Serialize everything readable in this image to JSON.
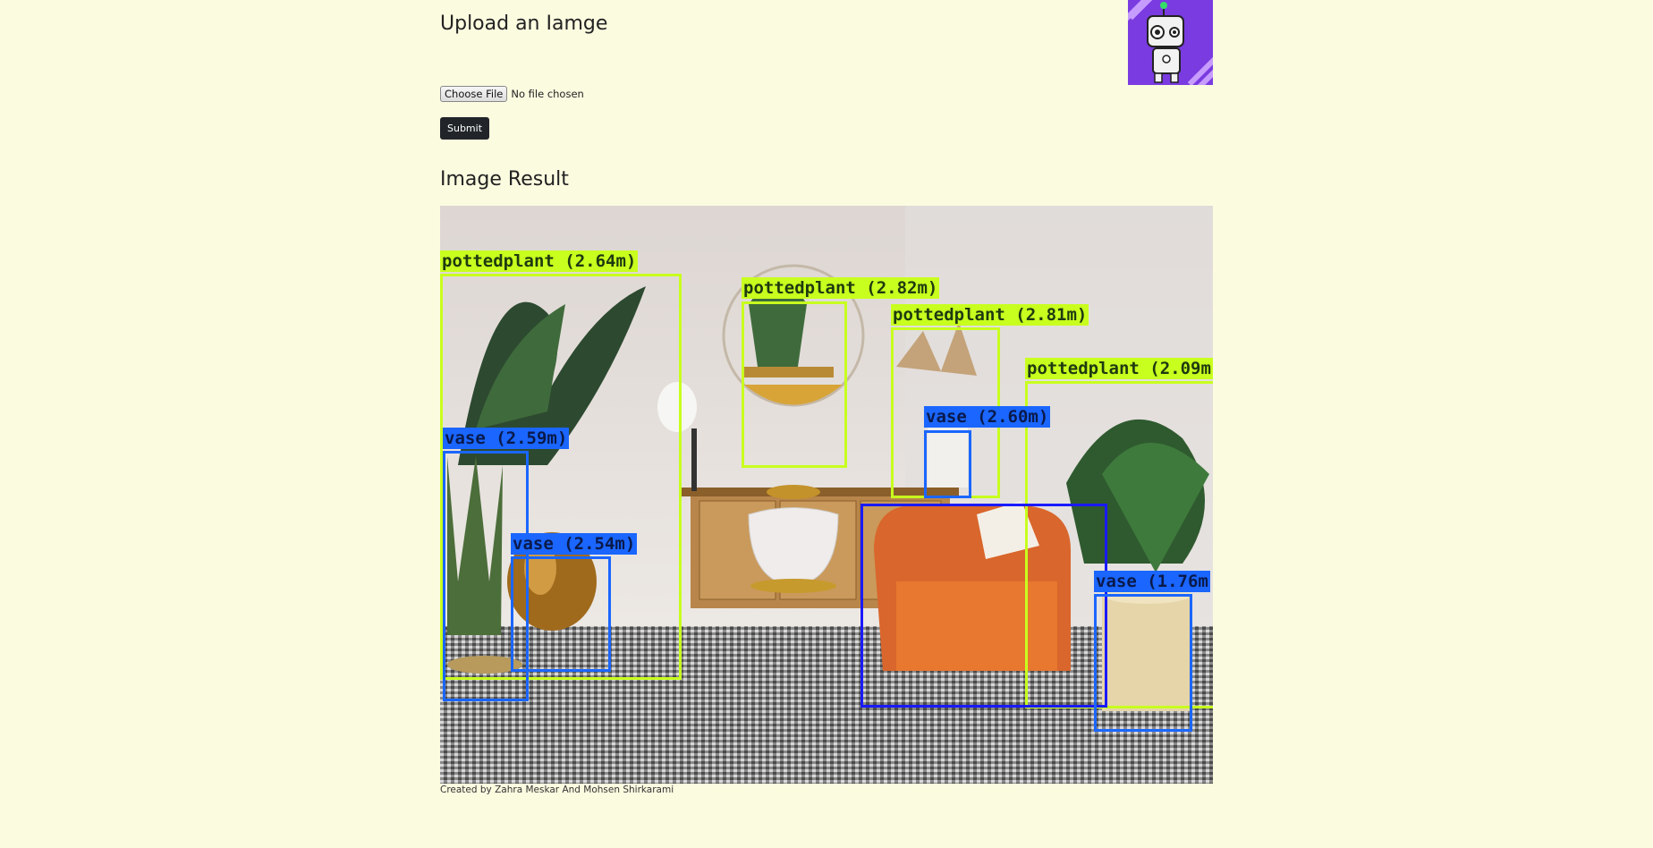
{
  "page": {
    "upload_heading": "Upload an Iamge",
    "choose_file_label": "Choose File",
    "file_status": "No file chosen",
    "submit_label": "Submit",
    "result_heading": "Image Result",
    "footer": "Created by Zahra Meskar And Mohsen Shirkarami"
  },
  "logo": {
    "icon": "robot-icon",
    "accent": "#7a3be0"
  },
  "detections": [
    {
      "class": "pottedplant",
      "label": "pottedplant (2.64m)",
      "color": "#c8ff1e"
    },
    {
      "class": "pottedplant",
      "label": "pottedplant (2.82m)",
      "color": "#c8ff1e"
    },
    {
      "class": "pottedplant",
      "label": "pottedplant (2.81m)",
      "color": "#c8ff1e"
    },
    {
      "class": "pottedplant",
      "label": "pottedplant (2.09m",
      "color": "#c8ff1e"
    },
    {
      "class": "vase",
      "label": "vase (2.59m)",
      "color": "#1a66ff"
    },
    {
      "class": "vase",
      "label": "vase (2.54m)",
      "color": "#1a66ff"
    },
    {
      "class": "vase",
      "label": "vase (2.60m)",
      "color": "#1a66ff"
    },
    {
      "class": "vase",
      "label": "vase (1.76m",
      "color": "#1a66ff"
    }
  ]
}
